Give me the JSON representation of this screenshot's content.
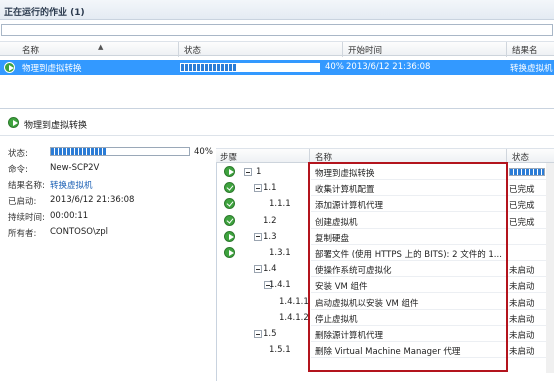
{
  "jobs_panel": {
    "title": "正在运行的作业 (1)",
    "columns": [
      "名称",
      "状态",
      "开始时间",
      "结果名"
    ],
    "rows": [
      {
        "name": "物理到虚拟转换",
        "progress_text": "40%",
        "progress": 0.4,
        "start_time": "2013/6/12 21:36:08",
        "result_name": "转换虚拟机"
      }
    ]
  },
  "detail": {
    "section_title": "物理到虚拟转换",
    "fields": [
      {
        "label": "状态:",
        "value": "",
        "progress": 0.4,
        "progress_text": "40%"
      },
      {
        "label": "命令:",
        "value": "New-SCP2V"
      },
      {
        "label": "结果名称:",
        "value": "转换虚拟机",
        "link": true
      },
      {
        "label": "已启动:",
        "value": "2013/6/12 21:36:08"
      },
      {
        "label": "持续时间:",
        "value": "00:00:11"
      },
      {
        "label": "所有者:",
        "value": "CONTOSO\\zpl"
      }
    ]
  },
  "steps": {
    "columns": [
      "步骤",
      "名称",
      "状态"
    ],
    "rows": [
      {
        "step": "1",
        "name": "物理到虚拟转换",
        "status": "",
        "icon": "play-icon",
        "expander": true,
        "level": 0
      },
      {
        "step": "1.1",
        "name": "收集计算机配置",
        "status": "已完成",
        "icon": "check-icon",
        "expander": true,
        "level": 1
      },
      {
        "step": "1.1.1",
        "name": "添加源计算机代理",
        "status": "已完成",
        "icon": "check-icon",
        "expander": false,
        "level": 2
      },
      {
        "step": "1.2",
        "name": "创建虚拟机",
        "status": "已完成",
        "icon": "check-icon",
        "expander": false,
        "level": 1
      },
      {
        "step": "1.3",
        "name": "复制硬盘",
        "status": "",
        "icon": "play-icon",
        "expander": true,
        "level": 1
      },
      {
        "step": "1.3.1",
        "name": "部署文件 (使用  HTTPS 上的 BITS): 2  文件的 1...",
        "status": "",
        "icon": "play-icon",
        "expander": false,
        "level": 2
      },
      {
        "step": "1.4",
        "name": "使操作系统可虚拟化",
        "status": "未启动",
        "icon": "",
        "expander": true,
        "level": 1
      },
      {
        "step": "1.4.1",
        "name": "安装 VM 组件",
        "status": "未启动",
        "icon": "",
        "expander": true,
        "level": 2
      },
      {
        "step": "1.4.1.1",
        "name": "启动虚拟机以安装 VM 组件",
        "status": "未启动",
        "icon": "",
        "expander": false,
        "level": 3
      },
      {
        "step": "1.4.1.2",
        "name": "停止虚拟机",
        "status": "未启动",
        "icon": "",
        "expander": false,
        "level": 3
      },
      {
        "step": "1.5",
        "name": "删除源计算机代理",
        "status": "未启动",
        "icon": "",
        "expander": true,
        "level": 1
      },
      {
        "step": "1.5.1",
        "name": "删除 Virtual Machine Manager 代理",
        "status": "未启动",
        "icon": "",
        "expander": false,
        "level": 2
      }
    ]
  },
  "colors": {
    "selection": "#3399ff",
    "progress": "#2b7cd6",
    "success": "#3ea33e",
    "highlight_box": "#b3141d"
  }
}
